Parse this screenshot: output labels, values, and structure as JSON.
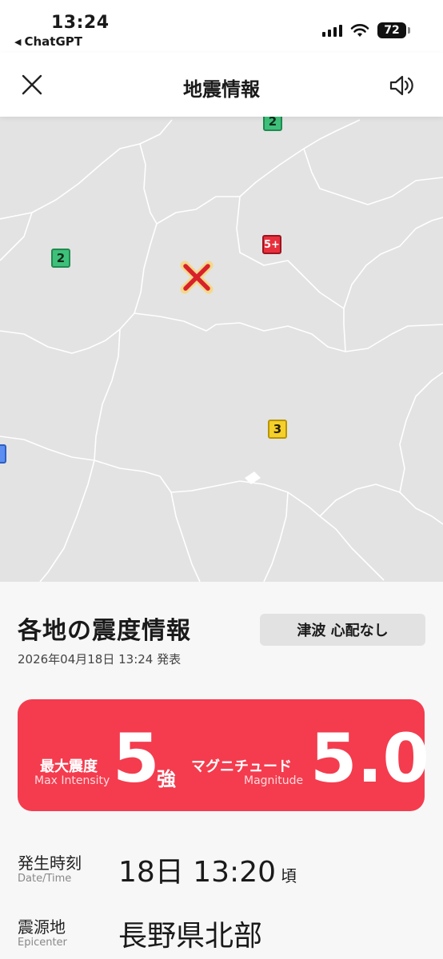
{
  "status_bar": {
    "time": "13:24",
    "back_app": "ChatGPT",
    "battery": "72"
  },
  "nav": {
    "title": "地震情報"
  },
  "map": {
    "markers": [
      {
        "label": "2",
        "intensity": "2"
      },
      {
        "label": "2",
        "intensity": "2"
      },
      {
        "label": "5+",
        "intensity": "5+"
      },
      {
        "label": "3",
        "intensity": "3"
      }
    ],
    "colors": {
      "intensity_2": "#3fc07a",
      "intensity_3": "#f5d02a",
      "intensity_5_plus": "#e8303c",
      "epicenter": "#d8222b"
    }
  },
  "panel": {
    "title": "各地の震度情報",
    "tsunami": "津波 心配なし",
    "published": "2026年04月18日 13:24 発表",
    "max_intensity_label": "最大震度",
    "max_intensity_sub": "Max Intensity",
    "max_intensity_value": "5",
    "max_intensity_unit": "強",
    "magnitude_label": "マグニチュード",
    "magnitude_sub": "Magnitude",
    "magnitude_value": "5.0",
    "accent_color": "#f43c4e",
    "datetime_label": "発生時刻",
    "datetime_sub": "Date/Time",
    "datetime_value": "18日 13:20",
    "datetime_suffix": "頃",
    "epicenter_label": "震源地",
    "epicenter_sub": "Epicenter",
    "epicenter_value": "長野県北部"
  }
}
